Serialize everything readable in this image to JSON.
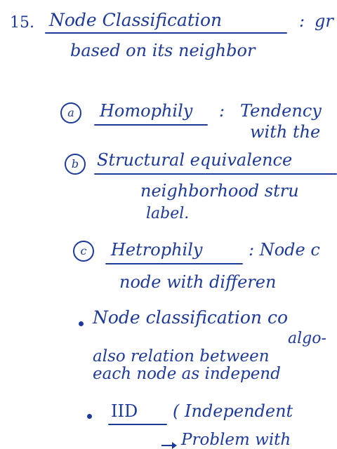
{
  "notes": {
    "item_number": "15.",
    "heading": "Node Classification",
    "heading_colon": ":",
    "heading_cont": "gr",
    "line2": "based on its neighbor",
    "a_marker": "a",
    "a_term": "Homophily",
    "a_colon": ":",
    "a_def_1": "Tendency",
    "a_def_2": "with the",
    "b_marker": "b",
    "b_term": "Structural equivalence",
    "b_def_1": "neighborhood stru",
    "b_def_2": "label.",
    "c_marker": "c",
    "c_term": "Hetrophily",
    "c_def_1": ": Node c",
    "c_def_2": "node with differen",
    "bullet1_1": "Node classification co",
    "bullet1_2": "algo-",
    "bullet1_3": "also relation between",
    "bullet1_4": "each node as independ",
    "bullet2_term": "IID",
    "bullet2_rest": "( Independent",
    "bullet2_arrow_text": "Problem with"
  },
  "colors": {
    "ink": "#1d3a9a",
    "paper": "#ffffff"
  }
}
